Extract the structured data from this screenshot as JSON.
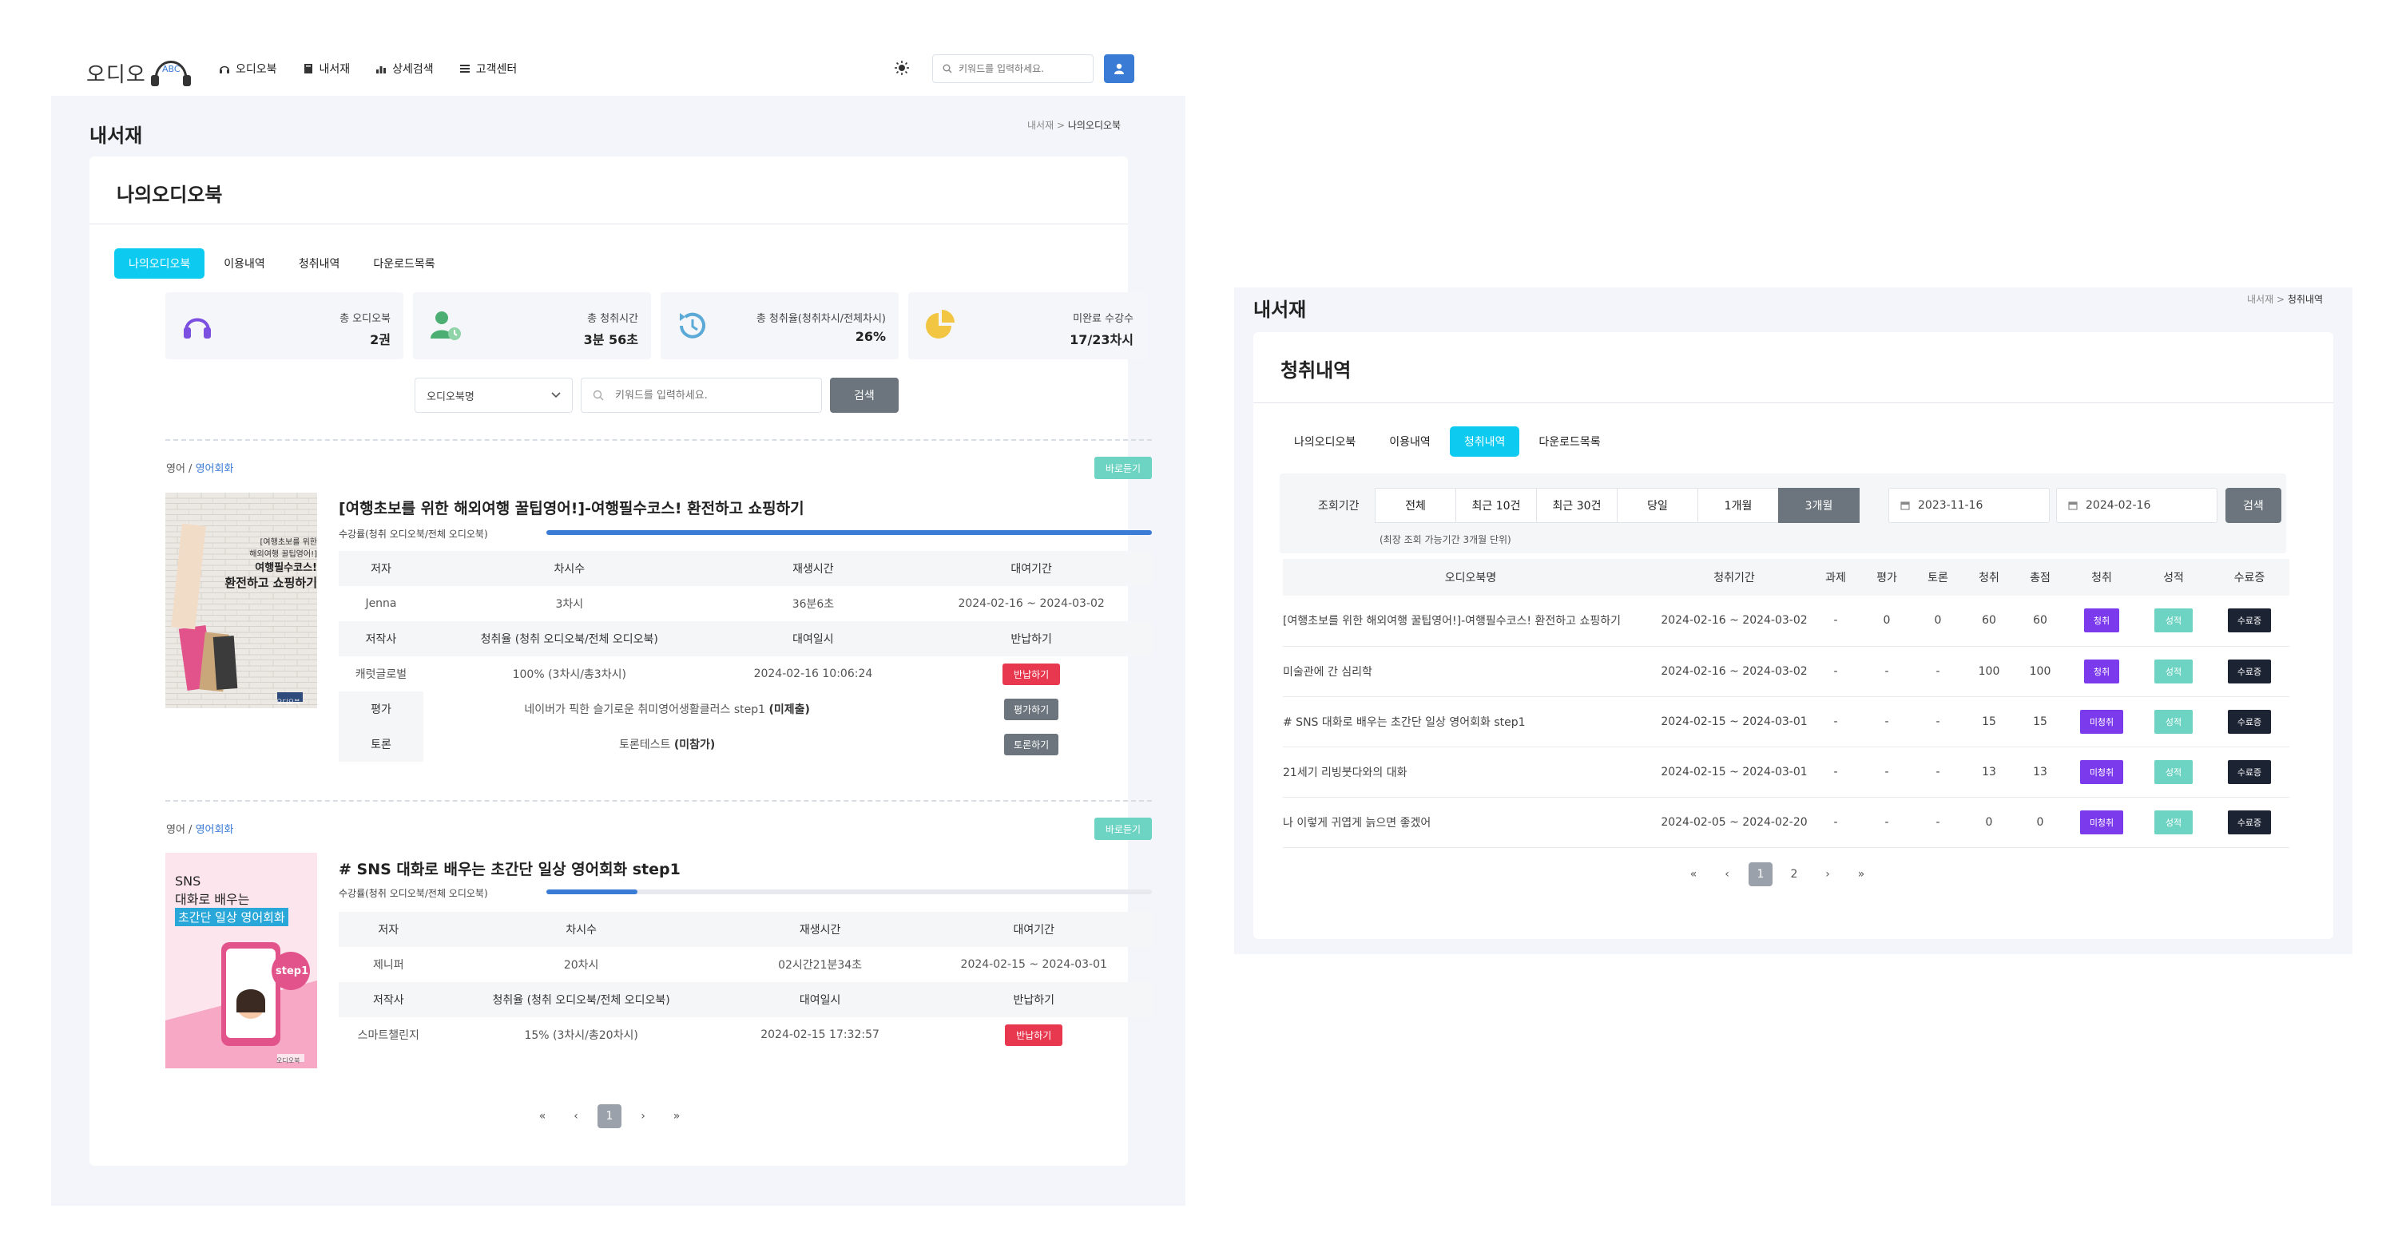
{
  "brand": {
    "logo_text": "오디오",
    "logo_mark_text": "오디오북",
    "accent": "#0dcaf0",
    "primary": "#3a7bd5"
  },
  "header": {
    "nav": [
      {
        "label": "오디오북",
        "icon": "headphones-icon"
      },
      {
        "label": "내서재",
        "icon": "book-icon"
      },
      {
        "label": "상세검색",
        "icon": "chart-icon"
      },
      {
        "label": "고객센터",
        "icon": "list-icon"
      }
    ],
    "search_placeholder": "키워드를 입력하세요."
  },
  "library": {
    "page_title": "내서재",
    "breadcrumb": {
      "root": "내서재",
      "sep": ">",
      "current": "나의오디오북"
    },
    "card_title": "나의오디오북",
    "tabs": [
      "나의오디오북",
      "이용내역",
      "청취내역",
      "다운로드목록"
    ],
    "active_tab": 0,
    "stats": [
      {
        "label": "총 오디오북",
        "value": "2권",
        "icon": "headphones-icon"
      },
      {
        "label": "총 청취시간",
        "value": "3분 56초",
        "icon": "user-clock-icon"
      },
      {
        "label": "총 청취율(청취차시/전체차시)",
        "value": "26%",
        "icon": "history-icon"
      },
      {
        "label": "미완료 수강수",
        "value": "17/23차시",
        "icon": "pie-chart-icon"
      }
    ],
    "filter": {
      "select_value": "오디오북명",
      "search_placeholder": "키워드를 입력하세요.",
      "search_button": "검색"
    },
    "books": [
      {
        "category": "영어",
        "subcategory": "영어회화",
        "quick_label": "바로듣기",
        "title": "[여행초보를 위한 해외여행 꿀팁영어!]-여행필수코스! 환전하고 쇼핑하기",
        "progress_label": "수강률(청취 오디오북/전체 오디오북)",
        "progress": 1.0,
        "cover_text": [
          "[여행초보를 위한",
          "해외여행 꿀팁영어!]",
          "여행필수코스!",
          "환전하고 쇼핑하기"
        ],
        "cover_footer": "오디오북",
        "h1": [
          "저자",
          "차시수",
          "재생시간",
          "대여기간"
        ],
        "r1": [
          "Jenna",
          "3차시",
          "36분6초",
          "2024-02-16 ~ 2024-03-02"
        ],
        "h2": [
          "저작사",
          "청취율 (청취 오디오북/전체 오디오북)",
          "대여일시",
          "반납하기"
        ],
        "r2": [
          "캐럿글로벌",
          "100% (3차시/총3차시)",
          "2024-02-16 10:06:24"
        ],
        "return_button": "반납하기",
        "review_label": "평가",
        "review_text": "네이버가 픽한 슬기로운 취미영어생활클러스 step1",
        "review_status": "(미제출)",
        "review_button": "평가하기",
        "discuss_label": "토론",
        "discuss_text": "토론테스트",
        "discuss_status": "(미참가)",
        "discuss_button": "토론하기"
      },
      {
        "category": "영어",
        "subcategory": "영어회화",
        "quick_label": "바로듣기",
        "title": "# SNS 대화로 배우는 초간단 일상 영어회화 step1",
        "progress_label": "수강률(청취 오디오북/전체 오디오북)",
        "progress": 0.15,
        "cover_text": [
          "SNS",
          "대화로 배우는",
          "초간단 일상 영어회화"
        ],
        "cover_badge": "step1",
        "cover_footer": "오디오북",
        "h1": [
          "저자",
          "차시수",
          "재생시간",
          "대여기간"
        ],
        "r1": [
          "제니퍼",
          "20차시",
          "02시간21분34초",
          "2024-02-15 ~ 2024-03-01"
        ],
        "h2": [
          "저작사",
          "청취율 (청취 오디오북/전체 오디오북)",
          "대여일시",
          "반납하기"
        ],
        "r2": [
          "스마트챌린지",
          "15% (3차시/총20차시)",
          "2024-02-15 17:32:57"
        ],
        "return_button": "반납하기"
      }
    ],
    "pager": [
      "«",
      "‹",
      "1",
      "›",
      "»"
    ],
    "pager_active": 2
  },
  "history": {
    "page_title": "내서재",
    "breadcrumb": {
      "root": "내서재",
      "sep": ">",
      "current": "청취내역"
    },
    "card_title": "청취내역",
    "tabs": [
      "나의오디오북",
      "이용내역",
      "청취내역",
      "다운로드목록"
    ],
    "active_tab": 2,
    "period_label": "조회기간",
    "periods": [
      "전체",
      "최근 10건",
      "최근 30건",
      "당일",
      "1개월",
      "3개월"
    ],
    "active_period": 5,
    "date_from": "2023-11-16",
    "date_to": "2024-02-16",
    "search_button": "검색",
    "note": "(최장 조회 가능기간 3개월 단위)",
    "columns": [
      "오디오북명",
      "청취기간",
      "과제",
      "평가",
      "토론",
      "청취",
      "총점",
      "청취",
      "성적",
      "수료증"
    ],
    "rows": [
      {
        "title": "[여행초보를 위한 해외여행 꿀팁영어!]-여행필수코스! 환전하고 쇼핑하기",
        "period": "2024-02-16 ~ 2024-03-02",
        "task": "-",
        "review": "0",
        "discuss": "0",
        "listen": "60",
        "total": "60",
        "status": "청취",
        "grade": "성적",
        "cert": "수료증"
      },
      {
        "title": "미술관에 간 심리학",
        "period": "2024-02-16 ~ 2024-03-02",
        "task": "-",
        "review": "-",
        "discuss": "-",
        "listen": "100",
        "total": "100",
        "status": "청취",
        "grade": "성적",
        "cert": "수료증"
      },
      {
        "title": "# SNS 대화로 배우는 초간단 일상 영어회화 step1",
        "period": "2024-02-15 ~ 2024-03-01",
        "task": "-",
        "review": "-",
        "discuss": "-",
        "listen": "15",
        "total": "15",
        "status": "미청취",
        "grade": "성적",
        "cert": "수료증"
      },
      {
        "title": "21세기 리빙붓다와의 대화",
        "period": "2024-02-15 ~ 2024-03-01",
        "task": "-",
        "review": "-",
        "discuss": "-",
        "listen": "13",
        "total": "13",
        "status": "미청취",
        "grade": "성적",
        "cert": "수료증"
      },
      {
        "title": "나 이렇게 귀엽게 늙으면 좋겠어",
        "period": "2024-02-05 ~ 2024-02-20",
        "task": "-",
        "review": "-",
        "discuss": "-",
        "listen": "0",
        "total": "0",
        "status": "미청취",
        "grade": "성적",
        "cert": "수료증"
      }
    ],
    "pager": [
      "«",
      "‹",
      "1",
      "2",
      "›",
      "»"
    ],
    "pager_active": 2
  }
}
